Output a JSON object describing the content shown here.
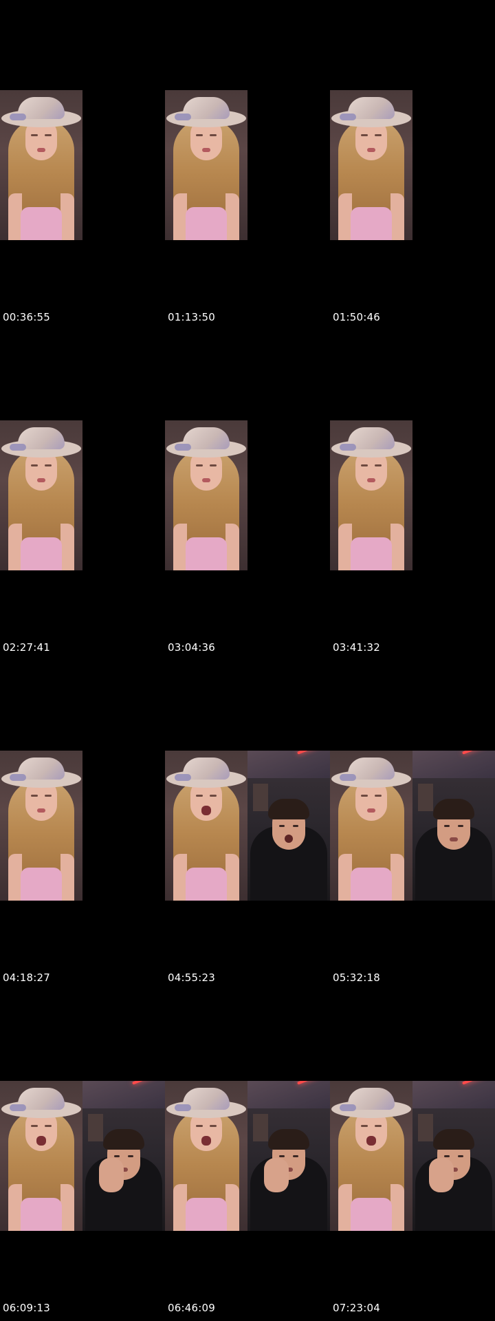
{
  "contact_sheet": {
    "background": "#000000",
    "thumbnails": [
      {
        "timestamp": "00:36:55",
        "scene": "solo"
      },
      {
        "timestamp": "01:13:50",
        "scene": "solo"
      },
      {
        "timestamp": "01:50:46",
        "scene": "solo"
      },
      {
        "timestamp": "02:27:41",
        "scene": "solo"
      },
      {
        "timestamp": "03:04:36",
        "scene": "solo"
      },
      {
        "timestamp": "03:41:32",
        "scene": "solo"
      },
      {
        "timestamp": "04:18:27",
        "scene": "solo"
      },
      {
        "timestamp": "04:55:23",
        "scene": "dual"
      },
      {
        "timestamp": "05:32:18",
        "scene": "dual"
      },
      {
        "timestamp": "06:09:13",
        "scene": "dual"
      },
      {
        "timestamp": "06:46:09",
        "scene": "dual"
      },
      {
        "timestamp": "07:23:04",
        "scene": "dual"
      }
    ]
  }
}
